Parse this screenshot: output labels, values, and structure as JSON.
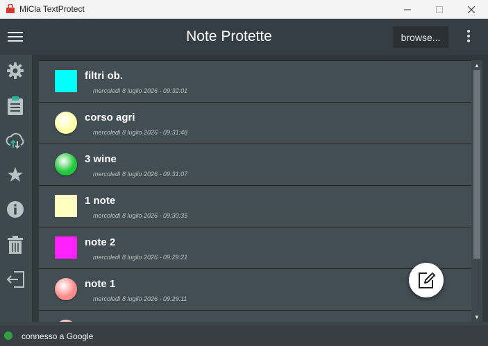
{
  "window": {
    "title": "MiCla TextProtect",
    "icon": "micla-app-icon"
  },
  "header": {
    "title": "Note Protette",
    "browse_label": "browse..."
  },
  "sidebar": {
    "items": [
      {
        "name": "settings",
        "icon": "gear-icon"
      },
      {
        "name": "clipboard",
        "icon": "clipboard-icon"
      },
      {
        "name": "cloud-sync",
        "icon": "cloud-sync-icon"
      },
      {
        "name": "favorites",
        "icon": "star-icon"
      },
      {
        "name": "info",
        "icon": "info-icon"
      },
      {
        "name": "trash",
        "icon": "trash-icon"
      },
      {
        "name": "logout",
        "icon": "exit-icon"
      }
    ]
  },
  "notes": [
    {
      "title": "filtri ob.",
      "date": "mercoledì 8 luglio 2026 - 09:32:01",
      "color": "#00ffff",
      "shape": "square"
    },
    {
      "title": "corso agri",
      "date": "mercoledì 8 luglio 2026 - 09:31:48",
      "color": "#ffffa8",
      "shape": "circle"
    },
    {
      "title": "3 wine",
      "date": "mercoledì 8 luglio 2026 - 09:31:07",
      "color": "#22c83c",
      "shape": "circle"
    },
    {
      "title": "1 note",
      "date": "mercoledì 8 luglio 2026 - 09:30:35",
      "color": "#ffffc0",
      "shape": "square"
    },
    {
      "title": "note 2",
      "date": "mercoledì 8 luglio 2026 - 09:29:21",
      "color": "#ff22ff",
      "shape": "square"
    },
    {
      "title": "note 1",
      "date": "mercoledì 8 luglio 2026 - 09:29:11",
      "color": "#ff8c8c",
      "shape": "circle"
    },
    {
      "title": "",
      "date": "",
      "color": "#ffb0b0",
      "shape": "circle"
    }
  ],
  "statusbar": {
    "text": "connesso a Google",
    "status_color": "#2ea043"
  },
  "fab": {
    "icon": "edit-note-icon"
  }
}
